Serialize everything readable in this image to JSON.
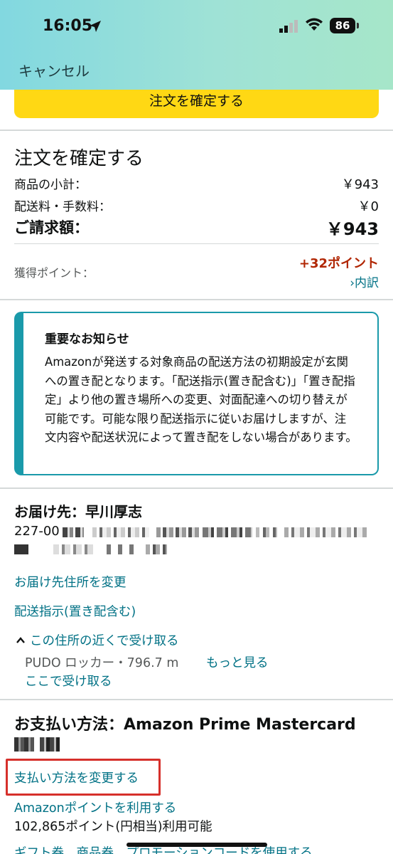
{
  "status_bar": {
    "time": "16:05",
    "battery": "86"
  },
  "header": {
    "cancel_label": "キャンセル"
  },
  "top_button": {
    "label": "注文を確定する"
  },
  "summary": {
    "title": "注文を確定する",
    "rows": [
      {
        "label": "商品の小計：",
        "value": "￥943"
      },
      {
        "label": "配送料・手数料：",
        "value": "￥0"
      }
    ],
    "total_label": "ご請求額：",
    "total_value": "￥943",
    "points_label": "獲得ポイント：",
    "points_value": "+32ポイント",
    "points_breakdown": "›内訳"
  },
  "notice": {
    "title": "重要なお知らせ",
    "body": "Amazonが発送する対象商品の配送方法の初期設定が玄関への置き配となります。「配送指示(置き配含む)」「置き配指定」より他の置き場所への変更、対面配達への切り替えが可能です。可能な限り配送指示に従いお届けしますが、注文内容や配送状況によって置き配をしない場合があります。"
  },
  "address": {
    "title": "お届け先：早川厚志",
    "postal_prefix": "227-00",
    "change_link": "お届け先住所を変更",
    "delivery_instructions_link": "配送指示(置き配含む)",
    "pickup_nearby_link": "この住所の近くで受け取る",
    "pudo_text": "PUDO ロッカー・796.7 m",
    "see_more_link": "もっと見る",
    "pickup_here_link": "ここで受け取る"
  },
  "payment": {
    "title": "お支払い方法：Amazon Prime Mastercard",
    "change_link": "支払い方法を変更する",
    "use_points_link": "Amazonポイントを利用する",
    "points_available": "102,865ポイント(円相当)利用可能",
    "gift_link": "ギフト券、商品券、プロモーションコードを使用する"
  },
  "colors": {
    "accent_link": "#007185",
    "button_yellow": "#ffd814",
    "points_red": "#b12704",
    "notice_border": "#1a9aaa",
    "highlight_red": "#d6302b"
  }
}
